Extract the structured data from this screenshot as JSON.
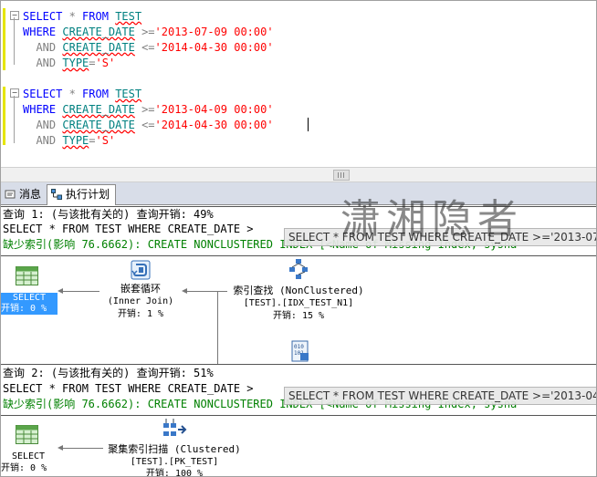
{
  "editor": {
    "block1": {
      "line1": [
        "SELECT",
        " * ",
        "FROM",
        " ",
        "TEST"
      ],
      "line2": {
        "kw": "WHERE",
        "col": "CREATE_DATE",
        "op": " >=",
        "val": "'2013-07-09 00:00'"
      },
      "line3": {
        "kw": "AND",
        "col": "CREATE_DATE",
        "op": " <=",
        "val": "'2014-04-30 00:00'"
      },
      "line4": {
        "kw": "AND",
        "col": "TYPE",
        "op": "=",
        "val": "'S'"
      }
    },
    "block2": {
      "line1": [
        "SELECT",
        " * ",
        "FROM",
        " ",
        "TEST"
      ],
      "line2": {
        "kw": "WHERE",
        "col": "CREATE_DATE",
        "op": " >=",
        "val": "'2013-04-09 00:00'"
      },
      "line3": {
        "kw": "AND",
        "col": "CREATE_DATE",
        "op": " <=",
        "val": "'2014-04-30 00:00'"
      },
      "line4": {
        "kw": "AND",
        "col": "TYPE",
        "op": "=",
        "val": "'S'"
      }
    }
  },
  "tabs": {
    "messages": "消息",
    "execution_plan": "执行计划"
  },
  "plan": {
    "query1": {
      "header": "查询 1: (与该批有关的) 查询开销: 49%",
      "sql": "SELECT * FROM TEST WHERE CREATE_DATE >",
      "missing": "缺少索引(影响 76.6662): CREATE NONCLUSTERED INDEX [<Name of Missing Index, sysna",
      "tooltip": "SELECT * FROM TEST  WHERE CREATE_DATE >='2013-07",
      "select_label": "SELECT",
      "select_cost": "开销: 0 %",
      "nested_name": "嵌套循环",
      "nested_sub": "(Inner Join)",
      "nested_cost": "开销: 1 %",
      "seek_name": "索引查找 (NonClustered)",
      "seek_obj": "[TEST].[IDX_TEST_N1]",
      "seek_cost": "开销: 15 %"
    },
    "query2": {
      "header": "查询 2: (与该批有关的) 查询开销: 51%",
      "sql": "SELECT * FROM TEST WHERE CREATE_DATE >",
      "missing": "缺少索引(影响 76.6662): CREATE NONCLUSTERED INDEX [<Name of Missing Index, sysna",
      "tooltip": "SELECT * FROM TEST  WHERE CREATE_DATE >='2013-04",
      "select_label": "SELECT",
      "select_cost": "开销: 0 %",
      "scan_name": "聚集索引扫描 (Clustered)",
      "scan_obj": "[TEST].[PK_TEST]",
      "scan_cost": "开销: 100 %"
    }
  },
  "watermark": "潇湘隐者",
  "colors": {
    "keyword": "#0000ff",
    "comparison": "#808080",
    "string": "#ff0000",
    "identifier": "#008080",
    "missing_index": "#008000",
    "selection": "#3399ff"
  }
}
